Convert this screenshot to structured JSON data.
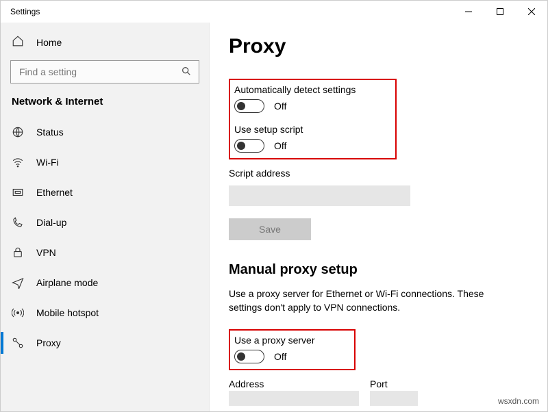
{
  "window": {
    "title": "Settings"
  },
  "sidebar": {
    "home": "Home",
    "search_placeholder": "Find a setting",
    "category": "Network & Internet",
    "items": [
      {
        "label": "Status"
      },
      {
        "label": "Wi-Fi"
      },
      {
        "label": "Ethernet"
      },
      {
        "label": "Dial-up"
      },
      {
        "label": "VPN"
      },
      {
        "label": "Airplane mode"
      },
      {
        "label": "Mobile hotspot"
      },
      {
        "label": "Proxy"
      }
    ]
  },
  "main": {
    "title": "Proxy",
    "auto_detect": {
      "label": "Automatically detect settings",
      "state": "Off"
    },
    "setup_script": {
      "label": "Use setup script",
      "state": "Off"
    },
    "script_address_label": "Script address",
    "save_label": "Save",
    "manual_heading": "Manual proxy setup",
    "manual_desc": "Use a proxy server for Ethernet or Wi-Fi connections. These settings don't apply to VPN connections.",
    "use_proxy": {
      "label": "Use a proxy server",
      "state": "Off"
    },
    "address_label": "Address",
    "port_label": "Port"
  },
  "watermark": "wsxdn.com"
}
